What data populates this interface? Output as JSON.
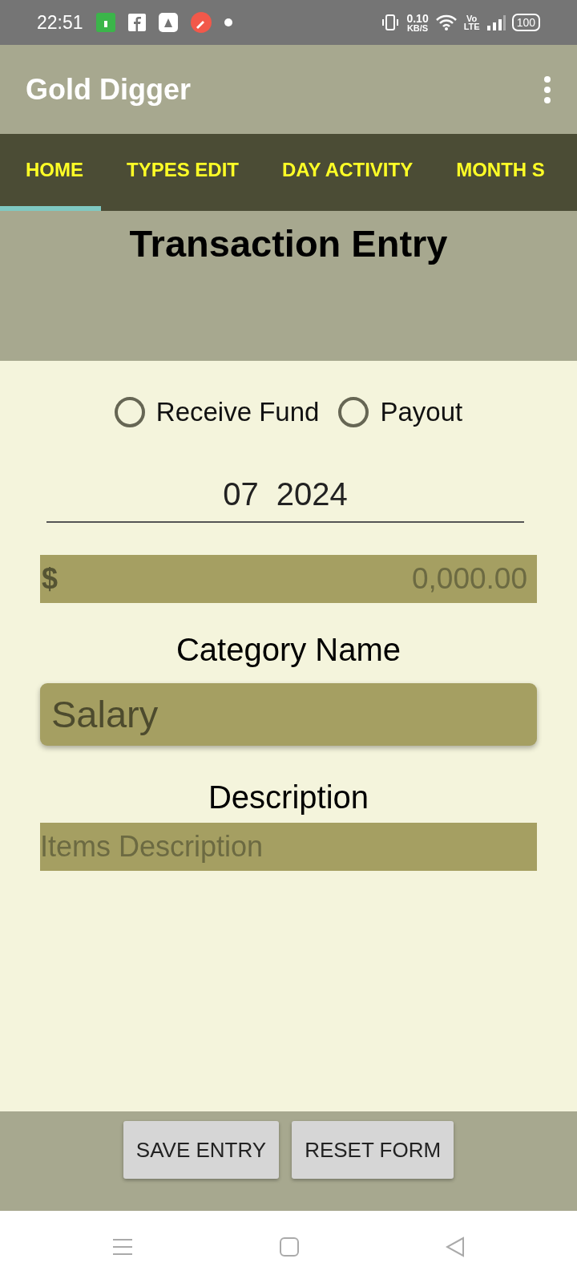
{
  "status_bar": {
    "time": "22:51",
    "net_speed": "0.10",
    "net_unit": "KB/S",
    "volte_top": "Vo",
    "volte_bottom": "LTE",
    "battery": "100"
  },
  "app_bar": {
    "title": "Gold Digger"
  },
  "tabs": [
    {
      "label": "HOME",
      "selected": true
    },
    {
      "label": "TYPES EDIT",
      "selected": false
    },
    {
      "label": "DAY ACTIVITY",
      "selected": false
    },
    {
      "label": "MONTH S",
      "selected": false
    }
  ],
  "heading": "Transaction Entry",
  "radios": [
    {
      "label": "Receive Fund",
      "selected": false
    },
    {
      "label": "Payout",
      "selected": false
    }
  ],
  "date_field": {
    "value": "07  2024"
  },
  "amount_field": {
    "prefix": "$",
    "placeholder": "0,000.00"
  },
  "category": {
    "label": "Category Name",
    "value": "Salary"
  },
  "description": {
    "label": "Description",
    "placeholder": "Items Description"
  },
  "buttons": [
    "SAVE ENTRY",
    "RESET FORM"
  ]
}
